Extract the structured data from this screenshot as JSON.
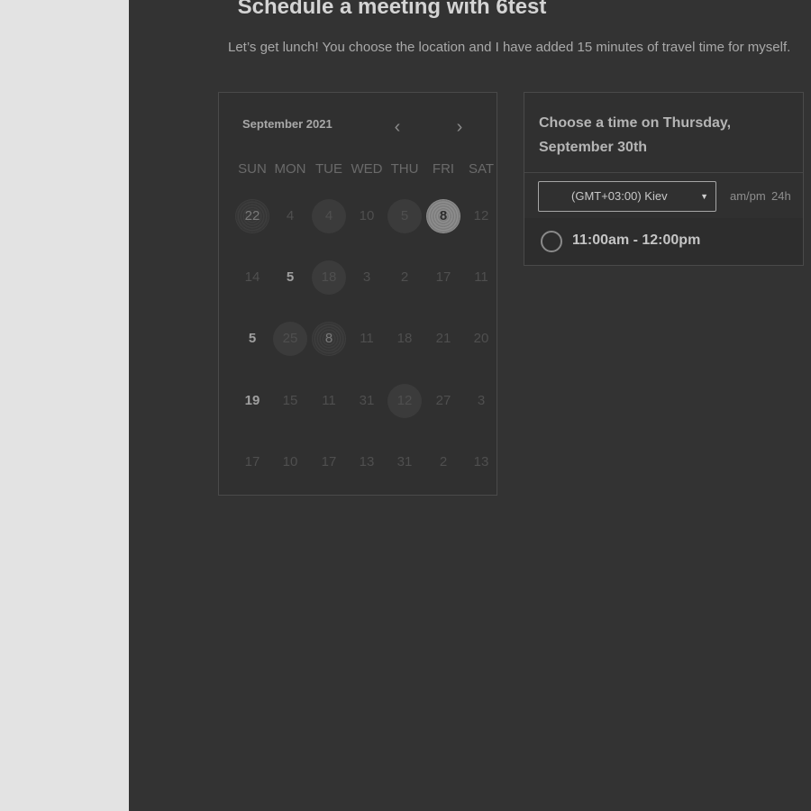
{
  "page": {
    "title": "Schedule a meeting with 6test",
    "subtitle": "Let’s get lunch! You choose the location and I have added 15 minutes of travel time for myself."
  },
  "calendar": {
    "month_label": "September 2021",
    "prev_icon": "chevron-left-icon",
    "next_icon": "chevron-right-icon",
    "prev_glyph": "‹",
    "next_glyph": "›",
    "weekdays": [
      "SUN",
      "MON",
      "TUE",
      "WED",
      "THU",
      "FRI",
      "SAT"
    ],
    "weeks": [
      [
        "22",
        "4",
        "4",
        "10",
        "5",
        "8",
        "12"
      ],
      [
        "14",
        "5",
        "18",
        "3",
        "2",
        "17",
        "11"
      ],
      [
        "5",
        "25",
        "8",
        "11",
        "18",
        "21",
        "20"
      ],
      [
        "19",
        "15",
        "11",
        "31",
        "12",
        "27",
        "3"
      ],
      [
        "17",
        "10",
        "17",
        "13",
        "31",
        "2",
        "13"
      ]
    ]
  },
  "times": {
    "heading": "Choose a time on Thursday, September 30th",
    "timezone": "(GMT+03:00) Kiev",
    "format_ampm": "am/pm",
    "format_24h": "24h",
    "slots": [
      "11:00am - 12:00pm"
    ]
  },
  "colors": {
    "background": "#333333",
    "sidebar": "#e3e3e3",
    "selected_day": "#8e8e8e"
  }
}
